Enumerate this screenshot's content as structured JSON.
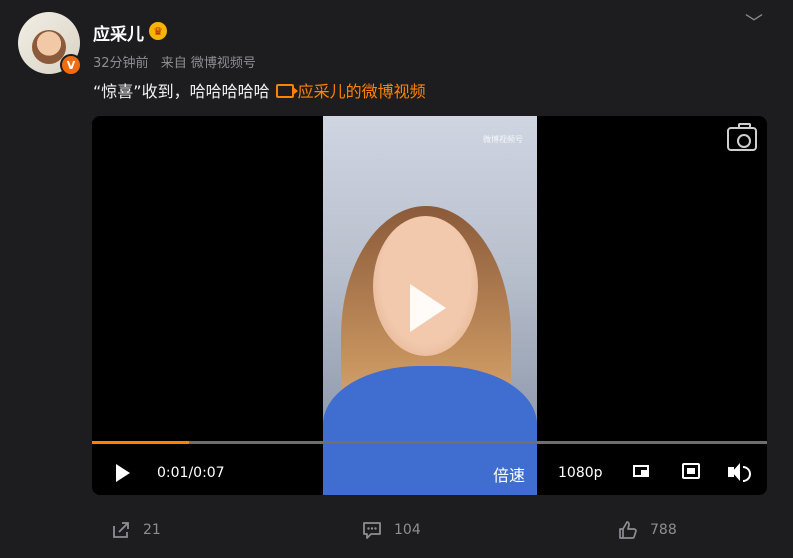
{
  "post": {
    "username": "应采儿",
    "meta": {
      "time": "32分钟前",
      "source": "来自 微博视频号"
    },
    "text": "“惊喜”收到，哈哈哈哈哈",
    "link_text": "应采儿的微博视频",
    "verified_badge": "V"
  },
  "video": {
    "watermark": "微博视频号",
    "progress_fraction": 0.143,
    "time_display": "0:01/0:07",
    "speed_label": "倍速",
    "quality_label": "1080p"
  },
  "actions": {
    "share_count": "21",
    "comment_count": "104",
    "like_count": "788"
  },
  "colors": {
    "background": "#1d1d20",
    "accent": "#ff8200",
    "muted": "#8d8d93"
  }
}
